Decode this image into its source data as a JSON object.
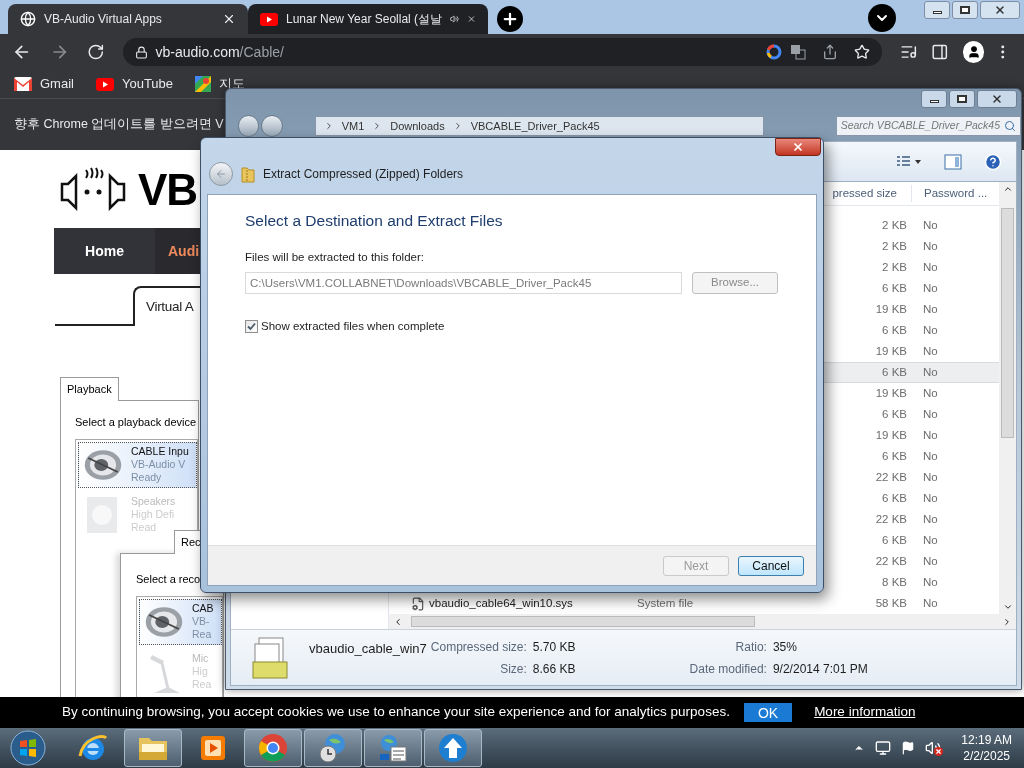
{
  "browser": {
    "tabs": [
      {
        "title": "VB-Audio Virtual Apps",
        "selected": true,
        "audio": false
      },
      {
        "title": "Lunar New Year Seollal (설날",
        "selected": false,
        "audio": true
      }
    ],
    "url_host": "vb-audio.com",
    "url_path": "/Cable/",
    "bookmarks": [
      {
        "label": "Gmail",
        "kind": "gmail"
      },
      {
        "label": "YouTube",
        "kind": "youtube"
      },
      {
        "label": "지도",
        "kind": "maps"
      }
    ],
    "infobar": "향후 Chrome 업데이트를 받으려면 V"
  },
  "page": {
    "logo": "VB",
    "nav": [
      {
        "label": "Home",
        "selected": false
      },
      {
        "label": "Audi",
        "selected": true
      }
    ],
    "tab": "Virtual A",
    "playback": {
      "tab": "Playback",
      "prompt": "Select a playback device",
      "devices": [
        {
          "name": "CABLE Inpu",
          "desc": "VB-Audio V",
          "status": "Ready",
          "selected": true,
          "kind": "cable"
        },
        {
          "name": "Speakers",
          "desc": "High Defi",
          "status": "Read",
          "selected": false,
          "kind": "speaker"
        }
      ]
    },
    "recording": {
      "tab": "Rec",
      "prompt": "Select a reco",
      "devices": [
        {
          "name": "CAB",
          "desc": "VB-",
          "status": "Rea",
          "selected": true,
          "kind": "cable"
        },
        {
          "name": "Mic",
          "desc": "Hig",
          "status": "Rea",
          "selected": false,
          "kind": "mic"
        }
      ]
    }
  },
  "explorer": {
    "breadcrumb": [
      "VM1",
      "Downloads",
      "VBCABLE_Driver_Pack45"
    ],
    "search_placeholder": "Search VBCABLE_Driver_Pack45",
    "columns": [
      "pressed size",
      "Password ..."
    ],
    "rows": [
      {
        "size": "2 KB",
        "password": "No",
        "highlighted": false
      },
      {
        "size": "2 KB",
        "password": "No",
        "highlighted": false
      },
      {
        "size": "2 KB",
        "password": "No",
        "highlighted": false
      },
      {
        "size": "6 KB",
        "password": "No",
        "highlighted": false
      },
      {
        "size": "19 KB",
        "password": "No",
        "highlighted": false
      },
      {
        "size": "6 KB",
        "password": "No",
        "highlighted": false
      },
      {
        "size": "19 KB",
        "password": "No",
        "highlighted": false
      },
      {
        "size": "6 KB",
        "password": "No",
        "highlighted": true
      },
      {
        "size": "19 KB",
        "password": "No",
        "highlighted": false
      },
      {
        "size": "6 KB",
        "password": "No",
        "highlighted": false
      },
      {
        "size": "19 KB",
        "password": "No",
        "highlighted": false
      },
      {
        "size": "6 KB",
        "password": "No",
        "highlighted": false
      },
      {
        "size": "22 KB",
        "password": "No",
        "highlighted": false
      },
      {
        "size": "6 KB",
        "password": "No",
        "highlighted": false
      },
      {
        "size": "22 KB",
        "password": "No",
        "highlighted": false
      },
      {
        "size": "6 KB",
        "password": "No",
        "highlighted": false
      },
      {
        "size": "22 KB",
        "password": "No",
        "highlighted": false
      },
      {
        "size": "8 KB",
        "password": "No",
        "highlighted": false
      },
      {
        "name": "vbaudio_cable64_win10.sys",
        "type": "System file",
        "size": "58 KB",
        "password": "No",
        "highlighted": false
      }
    ],
    "details": {
      "name": "vbaudio_cable_win7",
      "fields": [
        {
          "label": "Compressed size:",
          "value": "5.70 KB"
        },
        {
          "label": "Size:",
          "value": "8.66 KB"
        },
        {
          "label": "Ratio:",
          "value": "35%"
        },
        {
          "label": "Date modified:",
          "value": "9/2/2014 7:01 PM"
        }
      ]
    }
  },
  "dialog": {
    "title": "Extract Compressed (Zipped) Folders",
    "heading": "Select a Destination and Extract Files",
    "folder_label": "Files will be extracted to this folder:",
    "folder_value": "C:\\Users\\VM1.COLLABNET\\Downloads\\VBCABLE_Driver_Pack45",
    "folder_disabled": true,
    "browse": {
      "label": "Browse...",
      "disabled": true
    },
    "show_files": {
      "label": "Show extracted files when complete",
      "checked": true
    },
    "buttons": [
      {
        "label": "Next",
        "disabled": true
      },
      {
        "label": "Cancel",
        "disabled": false
      }
    ]
  },
  "cookie_bar": {
    "text": "By continuing browsing, you accept cookies we use to enhance your site experience and for analytics purposes.",
    "ok": "OK",
    "more": "More information"
  },
  "taskbar": {
    "apps": [
      {
        "kind": "ie",
        "running": false
      },
      {
        "kind": "folder",
        "running": true
      },
      {
        "kind": "media",
        "running": false
      },
      {
        "kind": "chrome",
        "running": true
      },
      {
        "kind": "globe",
        "running": true
      },
      {
        "kind": "network",
        "running": true
      },
      {
        "kind": "update",
        "running": true
      }
    ],
    "volume_muted": true,
    "time": "12:19 AM",
    "date": "2/2/2025"
  }
}
